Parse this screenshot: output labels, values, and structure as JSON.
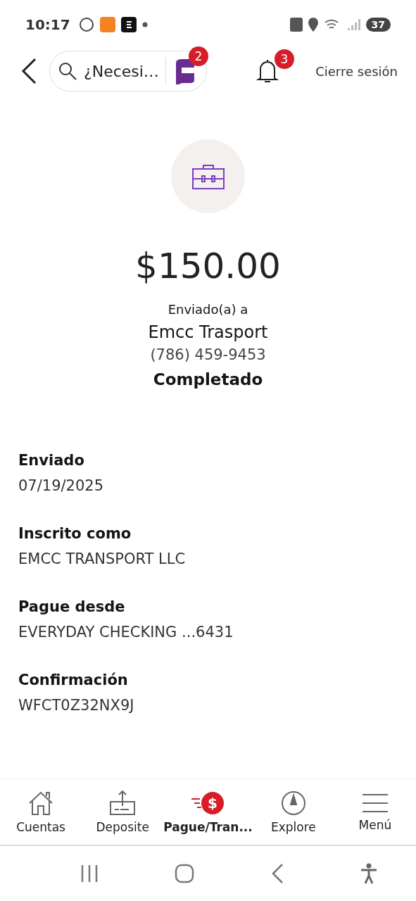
{
  "status_bar": {
    "time": "10:17",
    "battery": "37"
  },
  "header": {
    "search": {
      "placeholder": "¿Necesi…"
    },
    "assistant_badge": "2",
    "notifications_badge": "3",
    "logout": "Cierre sesión"
  },
  "summary": {
    "amount": "$150.00",
    "sent_to_label": "Enviado(a) a",
    "recipient": "Emcc Trasport",
    "phone": "(786) 459-9453",
    "status": "Completado"
  },
  "details": [
    {
      "label": "Enviado",
      "value": "07/19/2025"
    },
    {
      "label": "Inscrito como",
      "value": "EMCC TRANSPORT LLC"
    },
    {
      "label": "Pague desde",
      "value": "EVERYDAY CHECKING ...6431"
    },
    {
      "label": "Confirmación",
      "value": "WFCT0Z32NX9J"
    }
  ],
  "nav": [
    {
      "kind": "home",
      "label": "Cuentas",
      "selected": false
    },
    {
      "kind": "deposit",
      "label": "Deposite",
      "selected": false
    },
    {
      "kind": "pay",
      "label": "Pague/Tran...",
      "icon_text": "$",
      "selected": true
    },
    {
      "kind": "explore",
      "label": "Explore",
      "selected": false
    },
    {
      "kind": "menu",
      "label": "Menú",
      "selected": false
    }
  ]
}
